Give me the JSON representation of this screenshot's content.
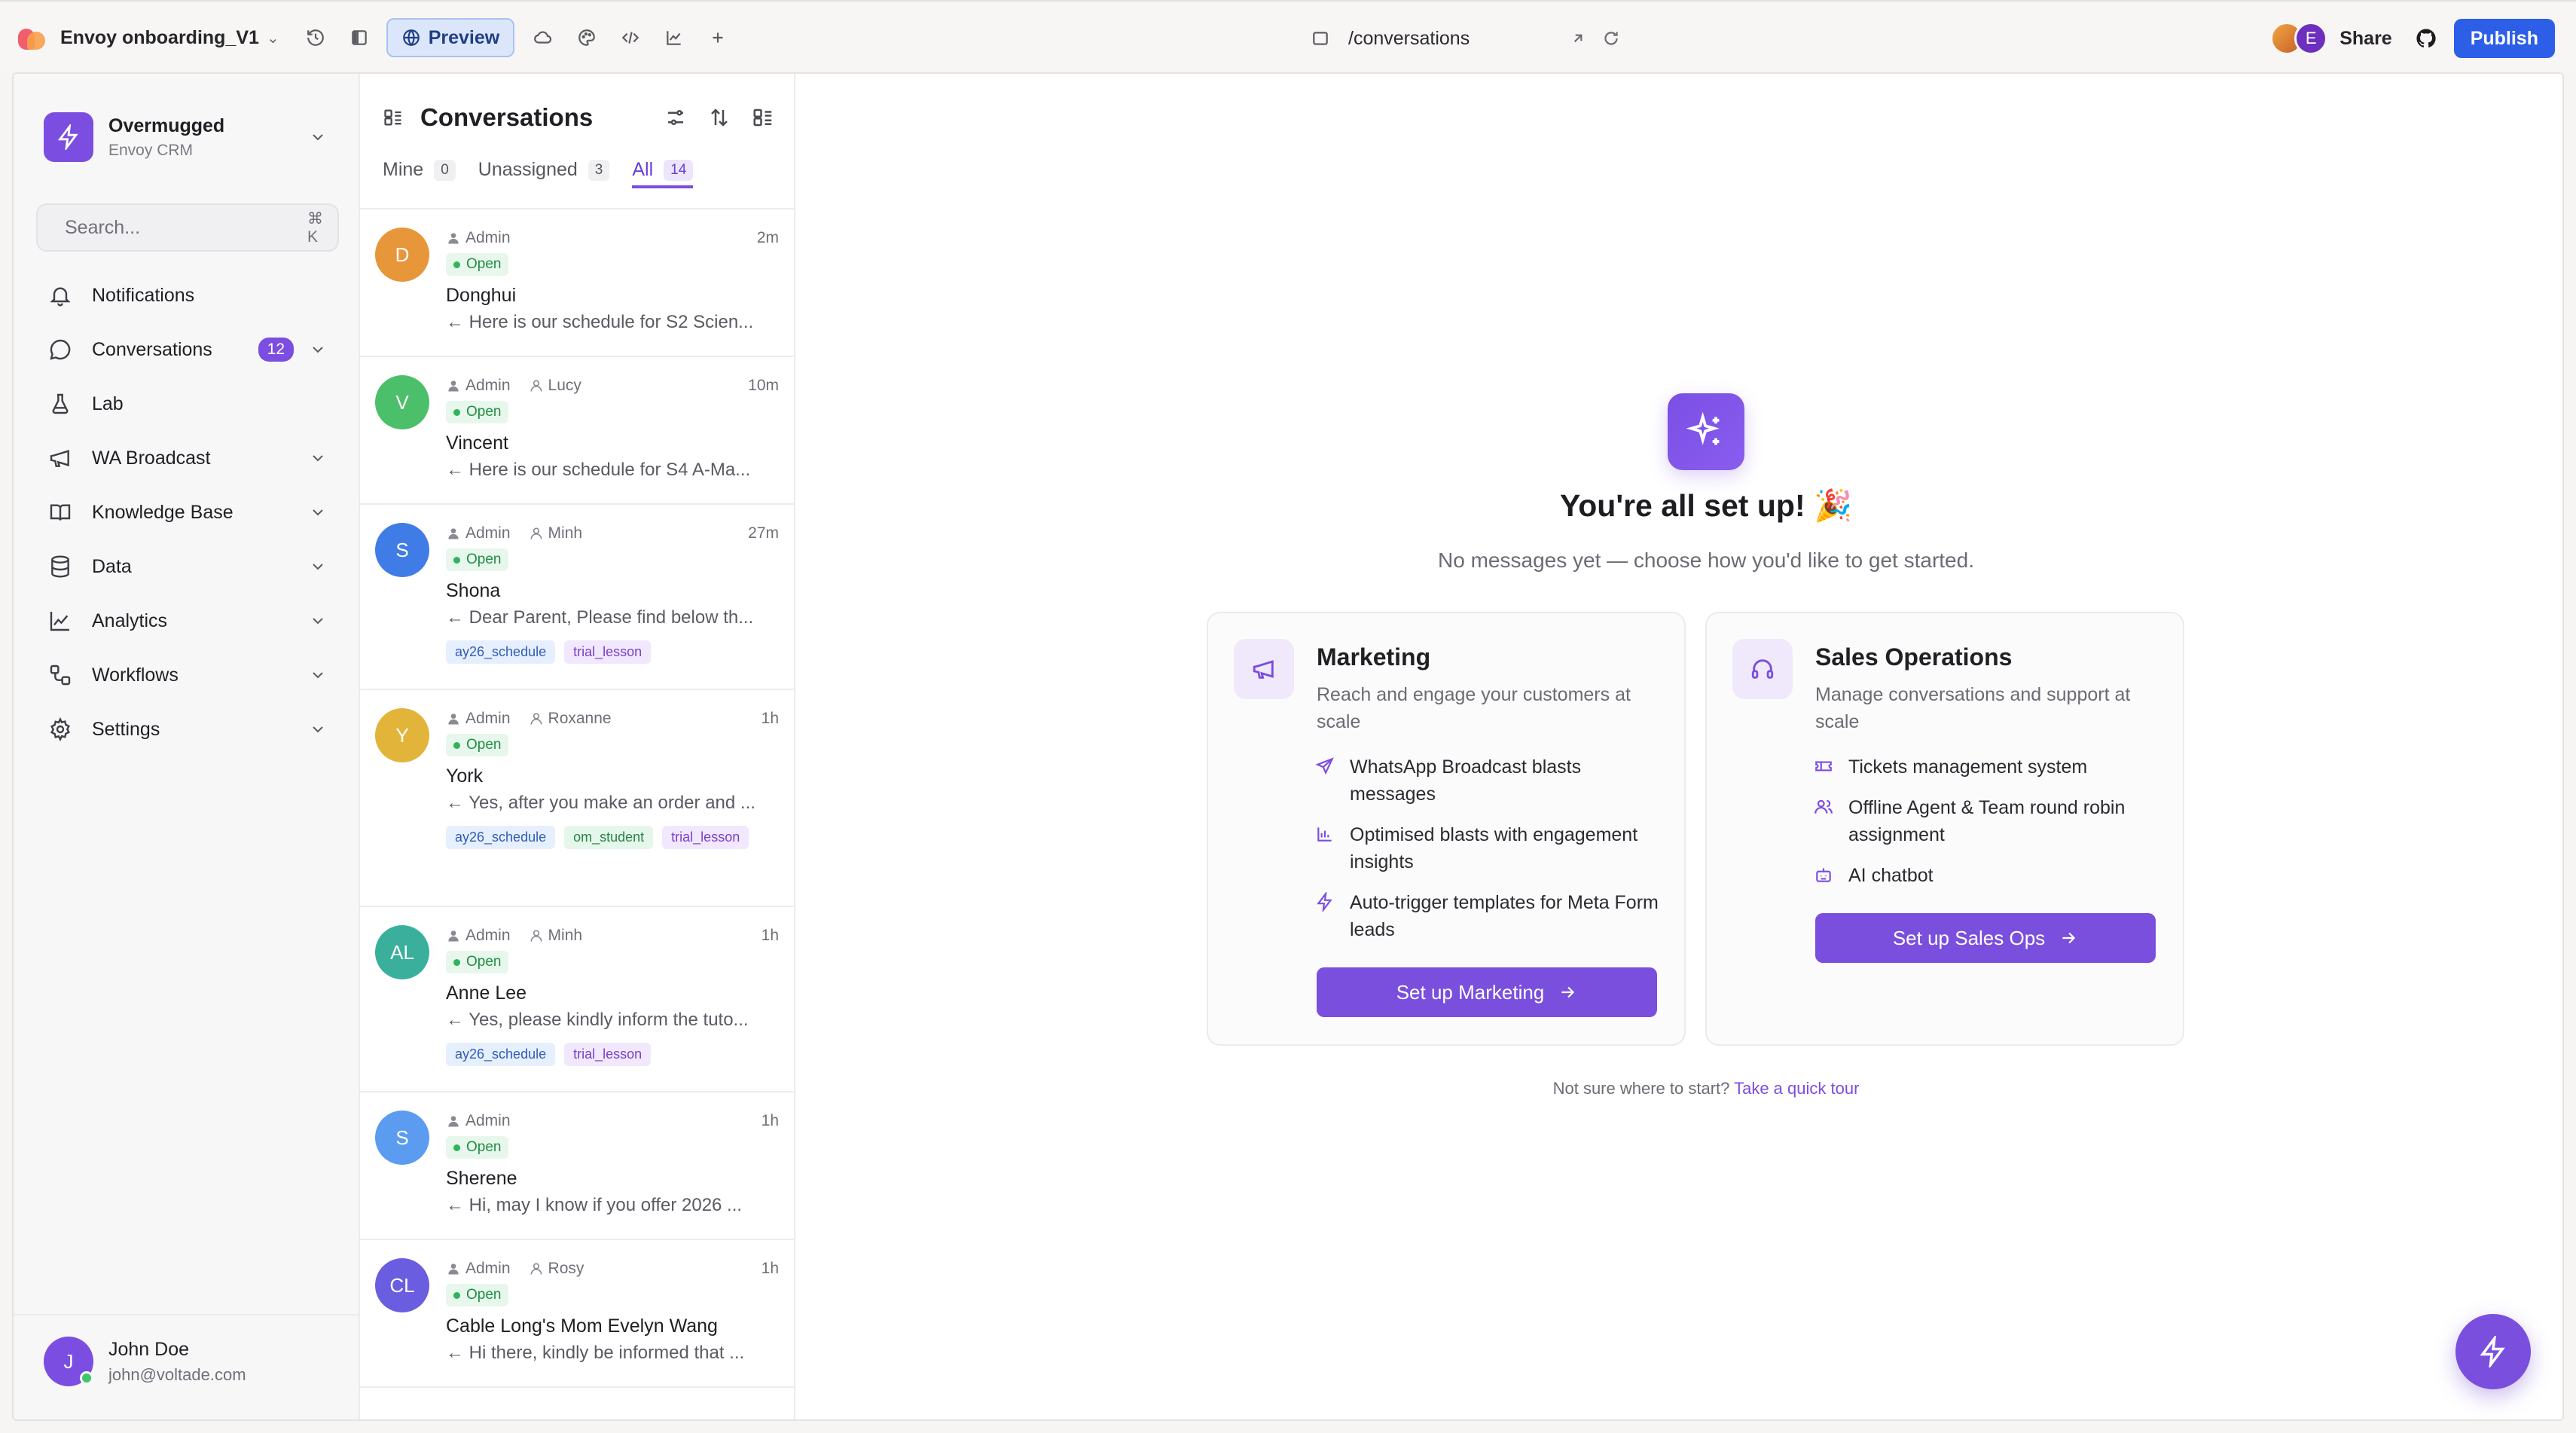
{
  "topbar": {
    "project_name": "Envoy onboarding_V1",
    "preview_label": "Preview",
    "url": "/conversations",
    "share_label": "Share",
    "publish_label": "Publish",
    "collaborator_initial": "E",
    "accent": "#2d5ee8"
  },
  "sidebar": {
    "workspace_name": "Overmugged",
    "workspace_sub": "Envoy CRM",
    "search_placeholder": "Search...",
    "search_shortcut": "⌘ K",
    "items": [
      {
        "label": "Notifications",
        "icon": "bell-icon"
      },
      {
        "label": "Conversations",
        "icon": "chat-icon",
        "badge": "12"
      },
      {
        "label": "Lab",
        "icon": "flask-icon"
      },
      {
        "label": "WA Broadcast",
        "icon": "megaphone-icon"
      },
      {
        "label": "Knowledge Base",
        "icon": "book-icon"
      },
      {
        "label": "Data",
        "icon": "database-icon"
      },
      {
        "label": "Analytics",
        "icon": "chart-icon"
      },
      {
        "label": "Workflows",
        "icon": "workflow-icon"
      },
      {
        "label": "Settings",
        "icon": "gear-icon"
      }
    ],
    "user": {
      "initial": "J",
      "name": "John Doe",
      "email": "john@voltade.com"
    }
  },
  "conversations": {
    "title": "Conversations",
    "tabs": [
      {
        "label": "Mine",
        "count": "0"
      },
      {
        "label": "Unassigned",
        "count": "3"
      },
      {
        "label": "All",
        "count": "14"
      }
    ],
    "rows": [
      {
        "initial": "D",
        "color": "#e8963a",
        "owner": "Admin",
        "assignee": "",
        "time": "2m",
        "status": "Open",
        "name": "Donghui",
        "preview": "← Here is our schedule for S2 Scien...",
        "tags": []
      },
      {
        "initial": "V",
        "color": "#4cbf6a",
        "owner": "Admin",
        "assignee": "Lucy",
        "time": "10m",
        "status": "Open",
        "name": "Vincent",
        "preview": "← Here is our schedule for S4 A-Ma...",
        "tags": []
      },
      {
        "initial": "S",
        "color": "#3f7ce6",
        "owner": "Admin",
        "assignee": "Minh",
        "time": "27m",
        "status": "Open",
        "name": "Shona",
        "preview": "← Dear Parent, Please find below th...",
        "tags": [
          "ay26_schedule",
          "trial_lesson"
        ]
      },
      {
        "initial": "Y",
        "color": "#e2b43a",
        "owner": "Admin",
        "assignee": "Roxanne",
        "time": "1h",
        "status": "Open",
        "name": "York",
        "preview": "← Yes, after you make an order and ...",
        "tags": [
          "ay26_schedule",
          "om_student",
          "trial_lesson"
        ]
      },
      {
        "initial": "AL",
        "color": "#3ab09c",
        "owner": "Admin",
        "assignee": "Minh",
        "time": "1h",
        "status": "Open",
        "name": "Anne Lee",
        "preview": "← Yes, please kindly inform the tuto...",
        "tags": [
          "ay26_schedule",
          "trial_lesson"
        ]
      },
      {
        "initial": "S",
        "color": "#5b9cf0",
        "owner": "Admin",
        "assignee": "",
        "time": "1h",
        "status": "Open",
        "name": "Sherene",
        "preview": "← Hi, may I know if you offer 2026 ...",
        "tags": []
      },
      {
        "initial": "CL",
        "color": "#6a5de0",
        "owner": "Admin",
        "assignee": "Rosy",
        "time": "1h",
        "status": "Open",
        "name": "Cable Long's Mom Evelyn Wang",
        "preview": "← Hi there, kindly be informed that ...",
        "tags": []
      }
    ]
  },
  "main": {
    "title": "You're all set up! 🎉",
    "subtitle": "No messages yet — choose how you'd like to get started.",
    "cards": [
      {
        "title": "Marketing",
        "desc": "Reach and engage your customers at scale",
        "features": [
          {
            "icon": "send-icon",
            "text": "WhatsApp Broadcast blasts messages"
          },
          {
            "icon": "bar-chart-icon",
            "text": "Optimised blasts with engagement insights"
          },
          {
            "icon": "zap-icon",
            "text": "Auto-trigger templates for Meta Form leads"
          }
        ],
        "cta": "Set up Marketing"
      },
      {
        "title": "Sales Operations",
        "desc": "Manage conversations and support at scale",
        "features": [
          {
            "icon": "ticket-icon",
            "text": "Tickets management system"
          },
          {
            "icon": "users-icon",
            "text": "Offline Agent & Team round robin assignment"
          },
          {
            "icon": "bot-icon",
            "text": "AI chatbot"
          }
        ],
        "cta": "Set up Sales Ops"
      }
    ],
    "hint_prefix": "Not sure where to start?",
    "hint_link": "Take a quick tour",
    "accent": "#7b4de0"
  }
}
